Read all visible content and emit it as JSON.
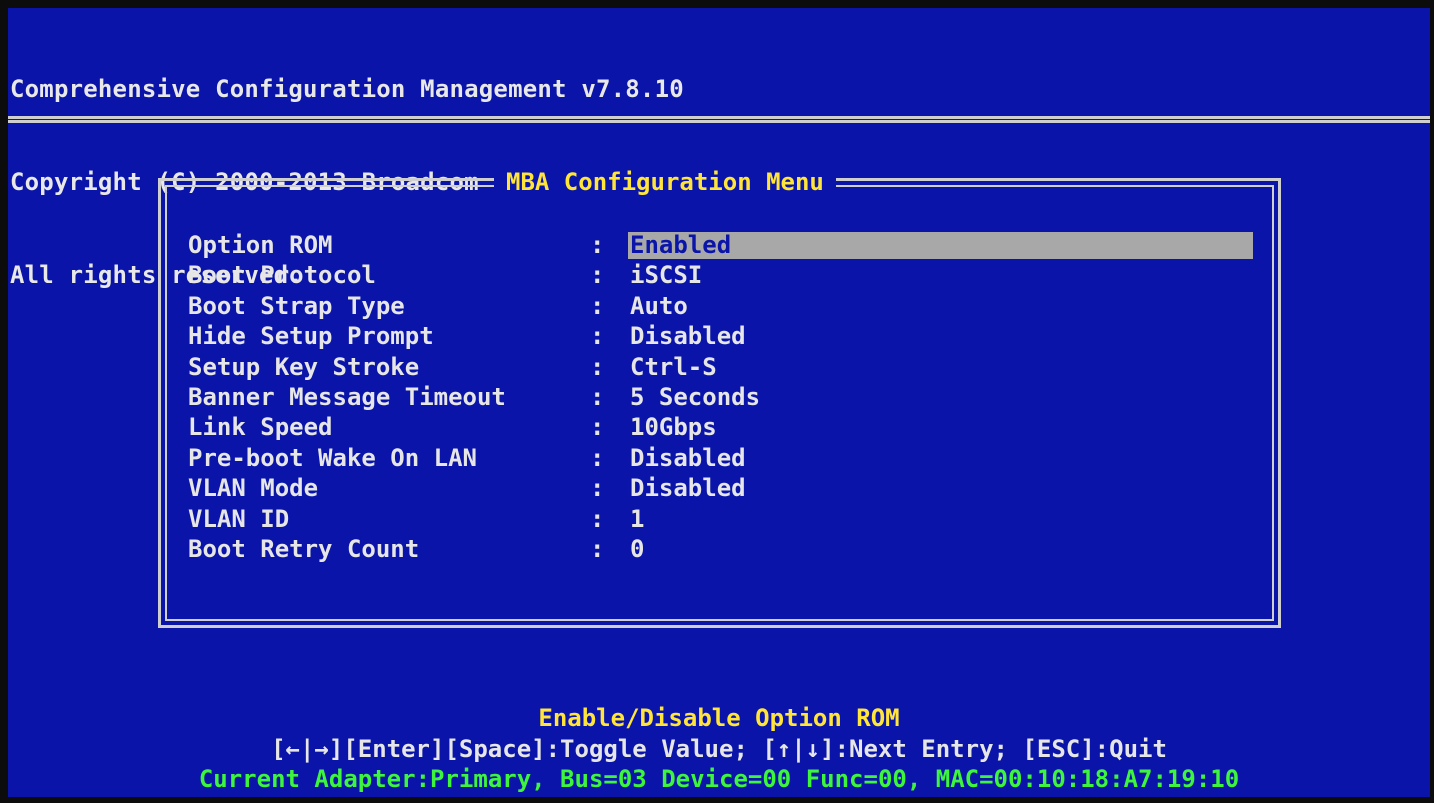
{
  "header": {
    "line1": "Comprehensive Configuration Management v7.8.10",
    "line2": "Copyright (C) 2000-2013 Broadcom Corporation",
    "line3": "All rights reserved."
  },
  "menu": {
    "title": "MBA Configuration Menu",
    "separator": ":",
    "selected_index": 0,
    "items": [
      {
        "label": "Option ROM",
        "value": "Enabled"
      },
      {
        "label": "Boot Protocol",
        "value": "iSCSI"
      },
      {
        "label": "Boot Strap Type",
        "value": "Auto"
      },
      {
        "label": "Hide Setup Prompt",
        "value": "Disabled"
      },
      {
        "label": "Setup Key Stroke",
        "value": "Ctrl-S"
      },
      {
        "label": "Banner Message Timeout",
        "value": "5 Seconds"
      },
      {
        "label": "Link Speed",
        "value": "10Gbps"
      },
      {
        "label": "Pre-boot Wake On LAN",
        "value": "Disabled"
      },
      {
        "label": "VLAN Mode",
        "value": "Disabled"
      },
      {
        "label": "VLAN ID",
        "value": "1"
      },
      {
        "label": "Boot Retry Count",
        "value": "0"
      }
    ]
  },
  "footer": {
    "description": "Enable/Disable Option ROM",
    "keys": "[←|→][Enter][Space]:Toggle Value; [↑|↓]:Next Entry; [ESC]:Quit",
    "adapter": "Current Adapter:Primary, Bus=03 Device=00 Func=00, MAC=00:10:18:A7:19:10"
  },
  "colors": {
    "background": "#0a14a8",
    "text": "#e6e6e6",
    "highlight": "#ffe53a",
    "status": "#3df53d",
    "selection_bar": "#a8a8a8"
  }
}
